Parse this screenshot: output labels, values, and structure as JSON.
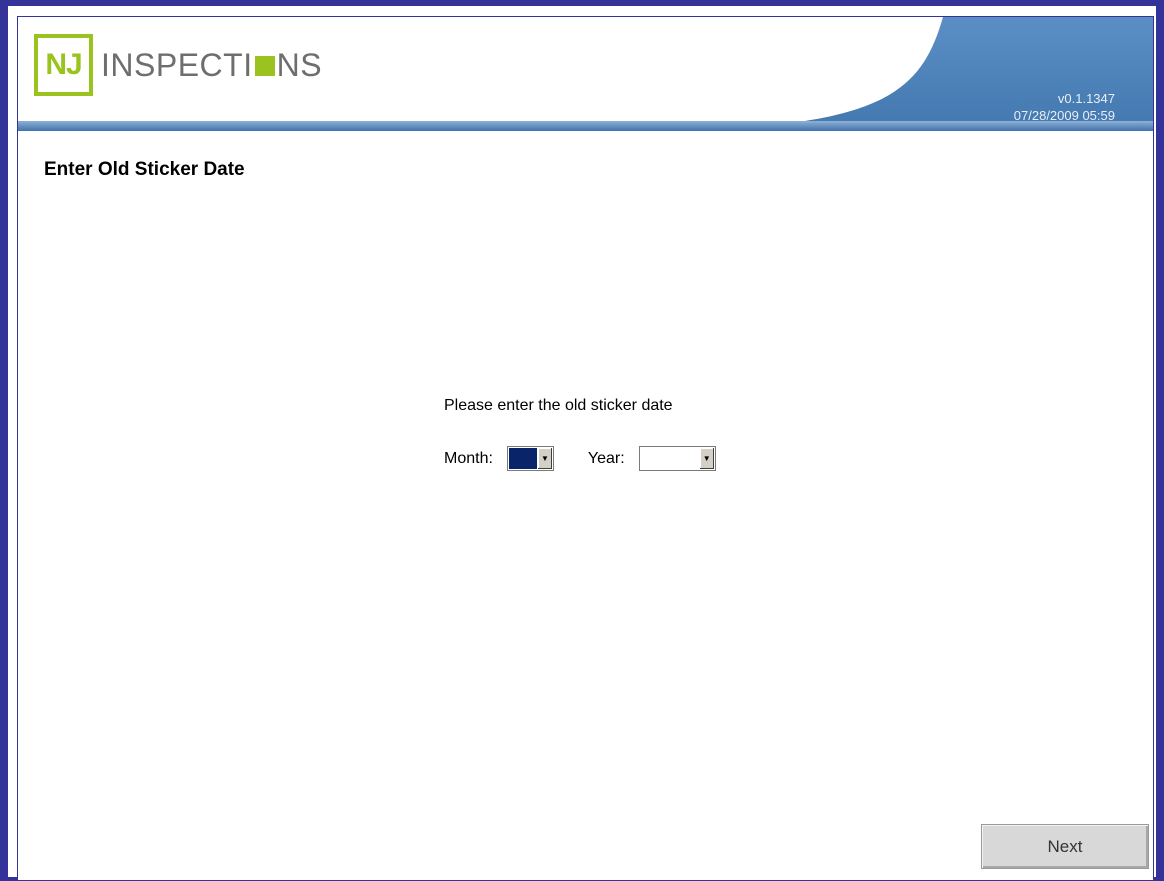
{
  "header": {
    "logo_badge": "NJ",
    "logo_text_start": "INSPECTI",
    "logo_text_end": "NS",
    "version": "v0.1.1347",
    "datetime": "07/28/2009 05:59"
  },
  "page": {
    "title": "Enter Old Sticker Date"
  },
  "form": {
    "prompt": "Please enter the old sticker date",
    "month_label": "Month:",
    "month_value": "",
    "year_label": "Year:",
    "year_value": ""
  },
  "footer": {
    "next_label": "Next"
  },
  "colors": {
    "frame": "#33339a",
    "header_blue": "#4f86bf",
    "logo_green": "#9ac320",
    "logo_gray": "#6d6e70",
    "selection_blue": "#0a246a"
  },
  "icons": {
    "dropdown": "chevron-down-icon"
  }
}
